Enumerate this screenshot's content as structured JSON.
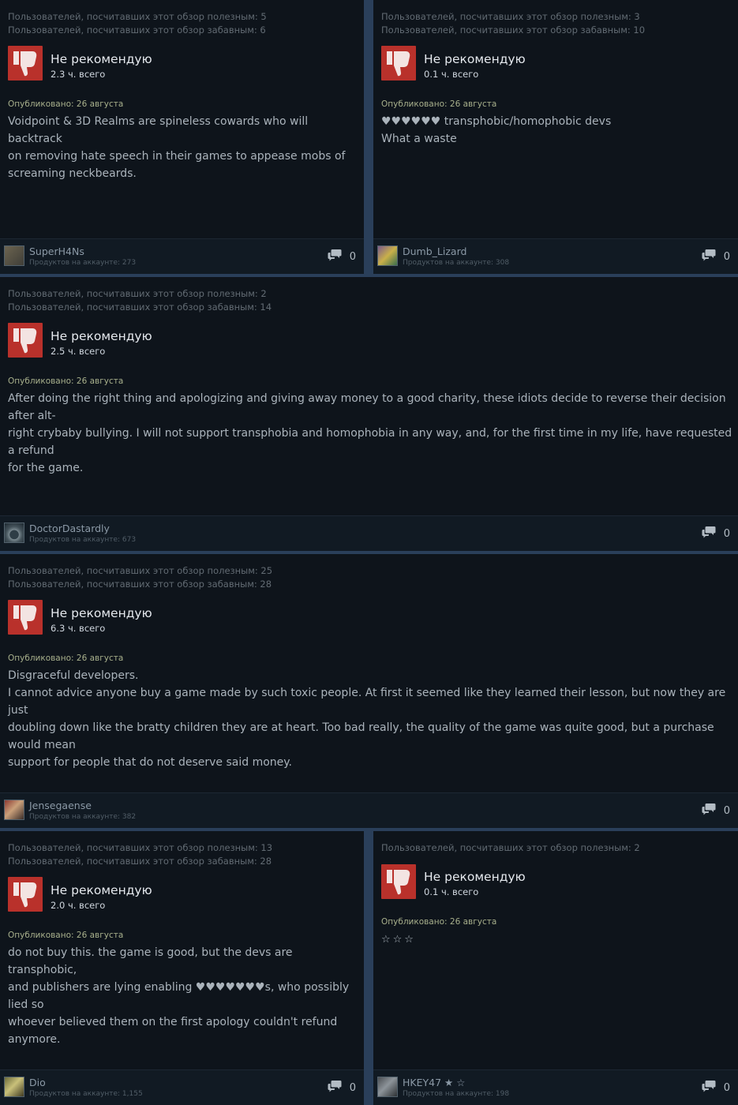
{
  "reviews": [
    {
      "helpful": "Пользователей, посчитавших этот обзор полезным: 5",
      "funny": "Пользователей, посчитавших этот обзор забавным: 6",
      "verdict": "Не рекомендую",
      "hours": "2.3 ч. всего",
      "posted": "Опубликовано: 26 августа",
      "text": "Voidpoint & 3D Realms are spineless cowards who will backtrack\non removing hate speech in their games to appease mobs of\nscreaming neckbeards.",
      "username": "SuperH4Ns",
      "products": "Продуктов на аккаунте: 273",
      "comments": "0"
    },
    {
      "helpful": "Пользователей, посчитавших этот обзор полезным: 3",
      "funny": "Пользователей, посчитавших этот обзор забавным: 10",
      "verdict": "Не рекомендую",
      "hours": "0.1 ч. всего",
      "posted": "Опубликовано: 26 августа",
      "text": "♥♥♥♥♥♥ transphobic/homophobic devs\nWhat a waste",
      "username": "Dumb_Lizard",
      "products": "Продуктов на аккаунте: 308",
      "comments": "0"
    },
    {
      "helpful": "Пользователей, посчитавших этот обзор полезным: 2",
      "funny": "Пользователей, посчитавших этот обзор забавным: 14",
      "verdict": "Не рекомендую",
      "hours": "2.5 ч. всего",
      "posted": "Опубликовано: 26 августа",
      "text": "After doing the right thing and apologizing and giving away money to a good charity, these idiots decide to reverse their decision after alt-\nright crybaby bullying. I will not support transphobia and homophobia in any way, and, for the first time in my life, have requested a refund\nfor the game.",
      "username": "DoctorDastardly",
      "products": "Продуктов на аккаунте: 673",
      "comments": "0"
    },
    {
      "helpful": "Пользователей, посчитавших этот обзор полезным: 25",
      "funny": "Пользователей, посчитавших этот обзор забавным: 28",
      "verdict": "Не рекомендую",
      "hours": "6.3 ч. всего",
      "posted": "Опубликовано: 26 августа",
      "text": "Disgraceful developers.\nI cannot advice anyone buy a game made by such toxic people. At first it seemed like they learned their lesson, but now they are just\ndoubling down like the bratty children they are at heart. Too bad really, the quality of the game was quite good, but a purchase would mean\nsupport for people that do not deserve said money.",
      "username": "Jensegaense",
      "products": "Продуктов на аккаунте: 382",
      "comments": "0"
    },
    {
      "helpful": "Пользователей, посчитавших этот обзор полезным: 13",
      "funny": "Пользователей, посчитавших этот обзор забавным: 28",
      "verdict": "Не рекомендую",
      "hours": "2.0 ч. всего",
      "posted": "Опубликовано: 26 августа",
      "text": "do not buy this. the game is good, but the devs are transphobic,\nand publishers are lying enabling ♥♥♥♥♥♥♥s, who possibly lied so\nwhoever believed them on the first apology couldn't refund\nanymore.",
      "username": "Dio",
      "products": "Продуктов на аккаунте: 1,155",
      "comments": "0"
    },
    {
      "helpful": "Пользователей, посчитавших этот обзор полезным: 2",
      "funny": "",
      "verdict": "Не рекомендую",
      "hours": "0.1 ч. всего",
      "posted": "Опубликовано: 26 августа",
      "text": "☆☆☆",
      "username": "HKEY47 ★ ☆",
      "products": "Продуктов на аккаунте: 198",
      "comments": "0"
    }
  ],
  "colors": {
    "background": "#0e141b",
    "separator": "#2a3f5a",
    "thumb": "#b9312b",
    "posted": "#a8b08c"
  },
  "icons": [
    "thumbs-down-icon",
    "comment-bubble-icon",
    "avatar"
  ]
}
